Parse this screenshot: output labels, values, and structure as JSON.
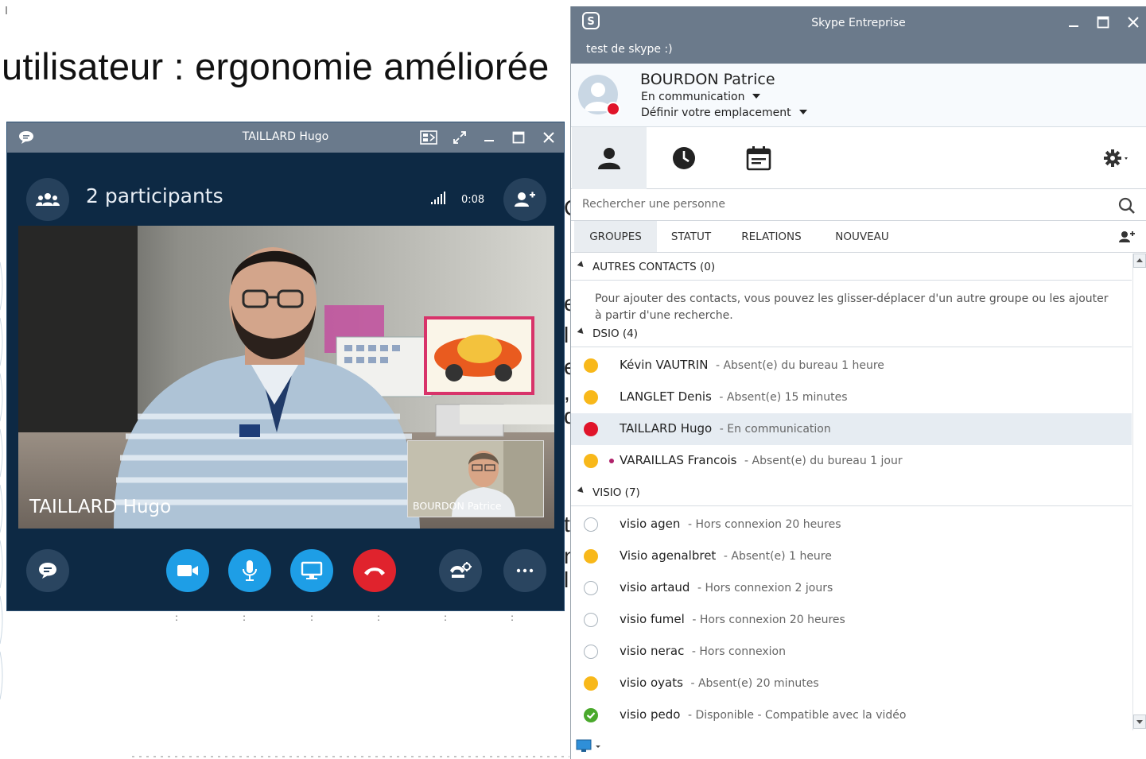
{
  "slide": {
    "title": "utilisateur : ergonomie améliorée",
    "fragments": [
      "C",
      "e",
      "l",
      "e",
      ",",
      "d",
      "t",
      "n",
      "l"
    ]
  },
  "conversation": {
    "window_title": "TAILLARD Hugo",
    "participants_label": "2 participants",
    "timer": "0:08",
    "remote_name": "TAILLARD Hugo",
    "self_name": "BOURDON Patrice"
  },
  "skype": {
    "window_title": "Skype Entreprise",
    "personal_note": "test de skype :)",
    "profile": {
      "name": "BOURDON Patrice",
      "status": "En communication",
      "location": "Définir votre emplacement"
    },
    "search": {
      "placeholder": "Rechercher une personne"
    },
    "tabs": [
      "GROUPES",
      "STATUT",
      "RELATIONS",
      "NOUVEAU"
    ],
    "groups": {
      "autres": {
        "label": "AUTRES CONTACTS (0)",
        "hint": "Pour ajouter des contacts, vous pouvez les glisser-déplacer d'un autre groupe ou les ajouter à partir d'une recherche."
      },
      "dsio": {
        "label": "DSIO (4)"
      },
      "visio": {
        "label": "VISIO (7)"
      }
    },
    "contacts": [
      {
        "name": "Kévin VAUTRIN",
        "status": "- Absent(e) du bureau 1 heure",
        "presence": "away"
      },
      {
        "name": "LANGLET Denis",
        "status": "- Absent(e) 15 minutes",
        "presence": "away"
      },
      {
        "name": "TAILLARD Hugo",
        "status": "- En communication",
        "presence": "busy"
      },
      {
        "name": "VARAILLAS Francois",
        "status": "- Absent(e) du bureau 1 jour",
        "presence": "away"
      },
      {
        "name": "visio agen",
        "status": "- Hors connexion 20 heures",
        "presence": "offline"
      },
      {
        "name": "Visio agenalbret",
        "status": "- Absent(e) 1 heure",
        "presence": "away"
      },
      {
        "name": "visio artaud",
        "status": "- Hors connexion 2 jours",
        "presence": "offline"
      },
      {
        "name": "visio fumel",
        "status": "- Hors connexion 20 heures",
        "presence": "offline"
      },
      {
        "name": "visio nerac",
        "status": "- Hors connexion",
        "presence": "offline"
      },
      {
        "name": "visio oyats",
        "status": "- Absent(e) 20 minutes",
        "presence": "away"
      },
      {
        "name": "visio pedo",
        "status": "- Disponible - Compatible avec la vidéo",
        "presence": "available"
      }
    ]
  },
  "colors": {
    "titlebar": "#6b7a8b",
    "conv_bg": "#0d2944",
    "accent_blue": "#1e9ee6",
    "hangup_red": "#e0232d",
    "away_yellow": "#f8b81a",
    "busy_red": "#e0142a",
    "available_green": "#4aa92c"
  }
}
